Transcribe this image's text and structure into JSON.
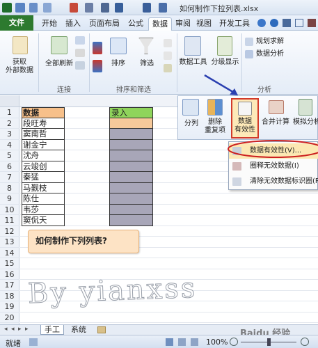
{
  "window": {
    "title": "如何制作下拉列表.xlsx"
  },
  "tabs": [
    "文件",
    "开始",
    "插入",
    "页面布局",
    "公式",
    "数据",
    "审阅",
    "视图",
    "开发工具"
  ],
  "ribbon": {
    "get_external_data": "获取\n外部数据",
    "refresh_all": "全部刷新",
    "sort": "排序",
    "filter": "筛选",
    "data_tools": "数据工具",
    "outline": "分级显示",
    "solver": "规划求解",
    "data_analysis": "数据分析",
    "groups": {
      "connections": "连接",
      "sort_filter": "排序和筛选",
      "analysis": "分析"
    }
  },
  "data_tools_panel": {
    "text_to_columns": "分列",
    "remove_duplicates": "删除\n重复项",
    "data_validation": "数据\n有效性",
    "consolidate": "合并计算",
    "what_if": "模拟分析"
  },
  "validation_menu": {
    "items": [
      "数据有效性(V)...",
      "圈释无效数据(I)",
      "清除无效数据标识圈(R)"
    ]
  },
  "sheet": {
    "columnA_header": "数据",
    "columnC_header": "录入",
    "names": [
      "段旺寿",
      "窦南哲",
      "谢金宁",
      "沈舟",
      "云竣创",
      "秦猛",
      "马觐枝",
      "陈仕",
      "韦莎",
      "窦侃天"
    ],
    "row_numbers": [
      "1",
      "2",
      "3",
      "4",
      "5",
      "6",
      "7",
      "8",
      "9",
      "10",
      "11",
      "12",
      "13",
      "14",
      "15",
      "16",
      "17",
      "18",
      "19",
      "20",
      "21",
      "22"
    ]
  },
  "callout": "如何制作下列列表?",
  "sheet_tabs": [
    "手工",
    "系统"
  ],
  "status": {
    "ready": "就绪",
    "zoom": "100%"
  },
  "watermark": "By yianxss",
  "baidu_mark": "Baidu 经验"
}
